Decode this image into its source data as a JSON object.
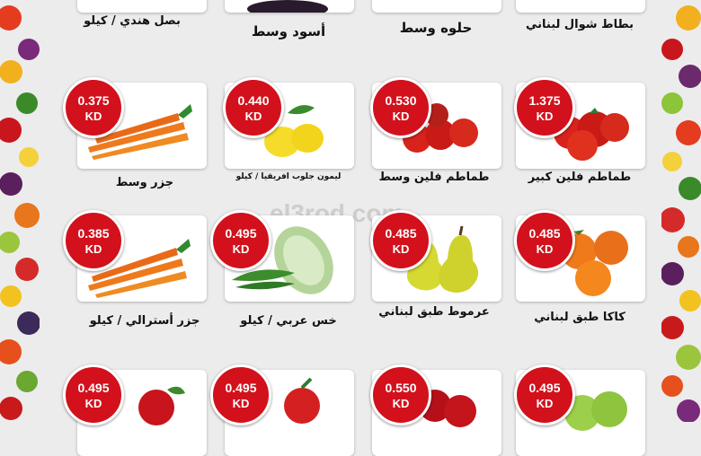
{
  "watermark": "el3rod.com",
  "currency": "KD",
  "top_row_names": [
    "بطاط شوال لبناني",
    "حلوه وسط",
    "أسود وسط",
    "بصل هندي / كيلو"
  ],
  "products": [
    {
      "name": "طماطم فلين كبير",
      "price": "1.375"
    },
    {
      "name": "طماطم فلين وسط",
      "price": "0.530"
    },
    {
      "name": "ليمون جلوب افريقيا / كيلو",
      "price": "0.440"
    },
    {
      "name": "جزر وسط",
      "price": "0.375"
    },
    {
      "name": "كاكا طبق لبناني",
      "price": "0.485"
    },
    {
      "name": "عرموط طبق لبناني",
      "price": "0.485"
    },
    {
      "name": "خس عربي / كيلو",
      "price": "0.495"
    },
    {
      "name": "جزر أسترالي / كيلو",
      "price": "0.385"
    },
    {
      "name": "",
      "price": "0.495"
    },
    {
      "name": "",
      "price": "0.550"
    },
    {
      "name": "",
      "price": "0.495"
    },
    {
      "name": "",
      "price": "0.495"
    }
  ],
  "colors": {
    "badge": "#d2111c",
    "background": "#ececec"
  }
}
